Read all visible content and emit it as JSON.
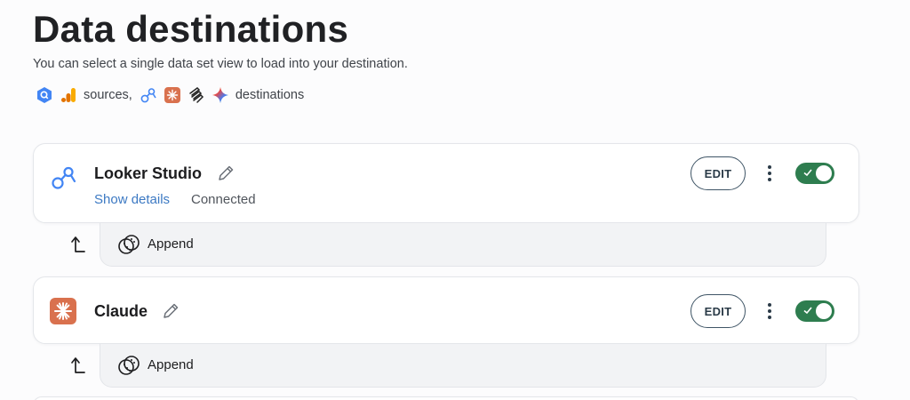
{
  "page": {
    "title": "Data destinations",
    "subtitle": "You can select a single data set view to load into your destination."
  },
  "integrations": {
    "source_icons": [
      "bigquery-icon",
      "google-analytics-icon"
    ],
    "sources_label": "sources,",
    "destination_icons": [
      "looker-studio-icon",
      "claude-icon",
      "perplexity-icon",
      "gemini-icon"
    ],
    "destinations_label": "destinations"
  },
  "colors": {
    "toggle_on": "#2e7d4f",
    "link": "#3c79c3",
    "claude_brand": "#d9714e",
    "looker_brand": "#4285f4"
  },
  "destinations": [
    {
      "name": "Looker Studio",
      "icon": "looker-studio-icon",
      "show_details_label": "Show details",
      "status": "Connected",
      "edit_label": "EDIT",
      "enabled": true,
      "mode_label": "Append"
    },
    {
      "name": "Claude",
      "icon": "claude-icon",
      "edit_label": "EDIT",
      "enabled": true,
      "mode_label": "Append"
    }
  ]
}
